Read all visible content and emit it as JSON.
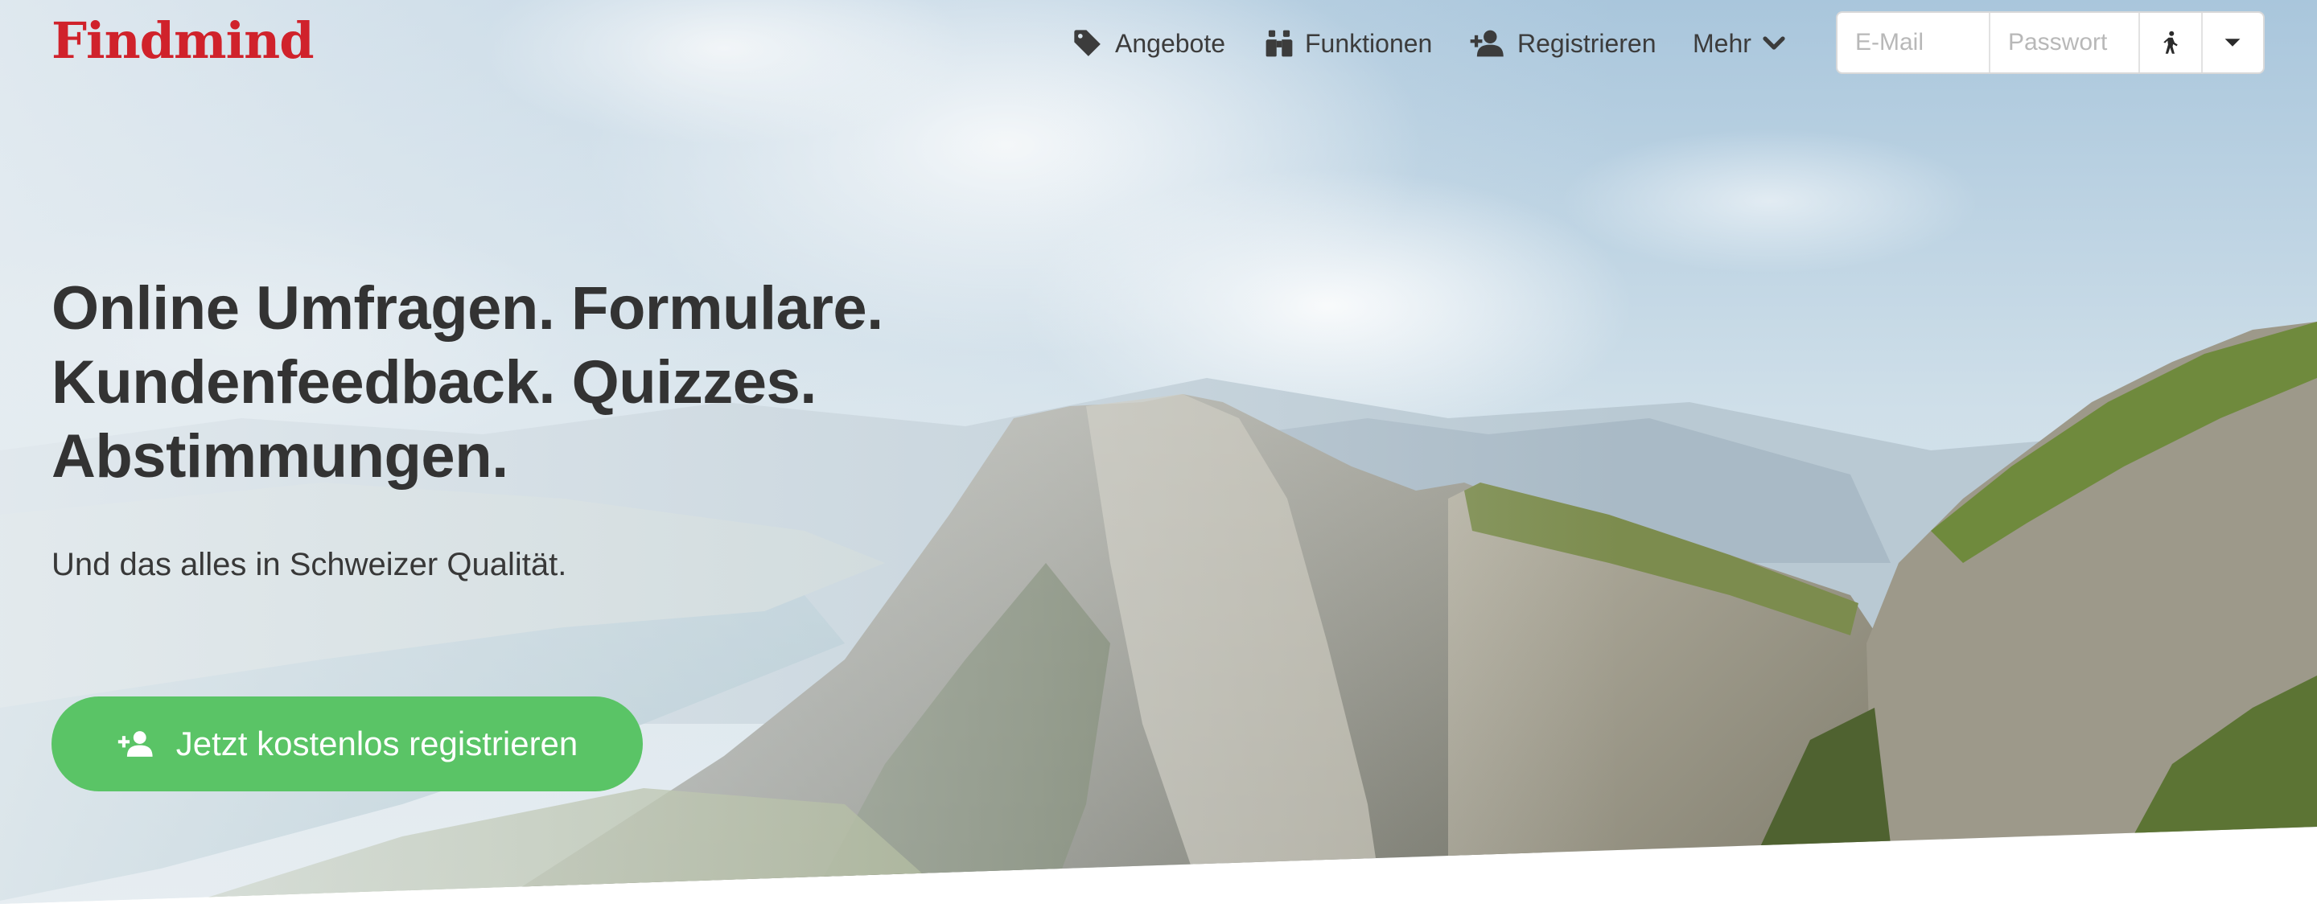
{
  "brand": {
    "logo_text": "Findmind",
    "color": "#d0222b"
  },
  "nav": {
    "items": [
      {
        "label": "Angebote",
        "icon": "tag-icon"
      },
      {
        "label": "Funktionen",
        "icon": "binoculars-icon"
      },
      {
        "label": "Registrieren",
        "icon": "user-plus-icon"
      },
      {
        "label": "Mehr",
        "icon": "chevron-down-icon"
      }
    ]
  },
  "login": {
    "email_placeholder": "E-Mail",
    "password_placeholder": "Passwort",
    "submit_icon": "walking-person-icon",
    "menu_icon": "caret-down-icon"
  },
  "hero": {
    "headline": [
      "Online Umfragen. Formulare.",
      "Kundenfeedback. Quizzes.",
      "Abstimmungen."
    ],
    "subline": "Und das alles in Schweizer Qualität.",
    "cta_label": "Jetzt kostenlos registrieren",
    "cta_icon": "user-plus-icon",
    "cta_color": "#5ac466"
  }
}
